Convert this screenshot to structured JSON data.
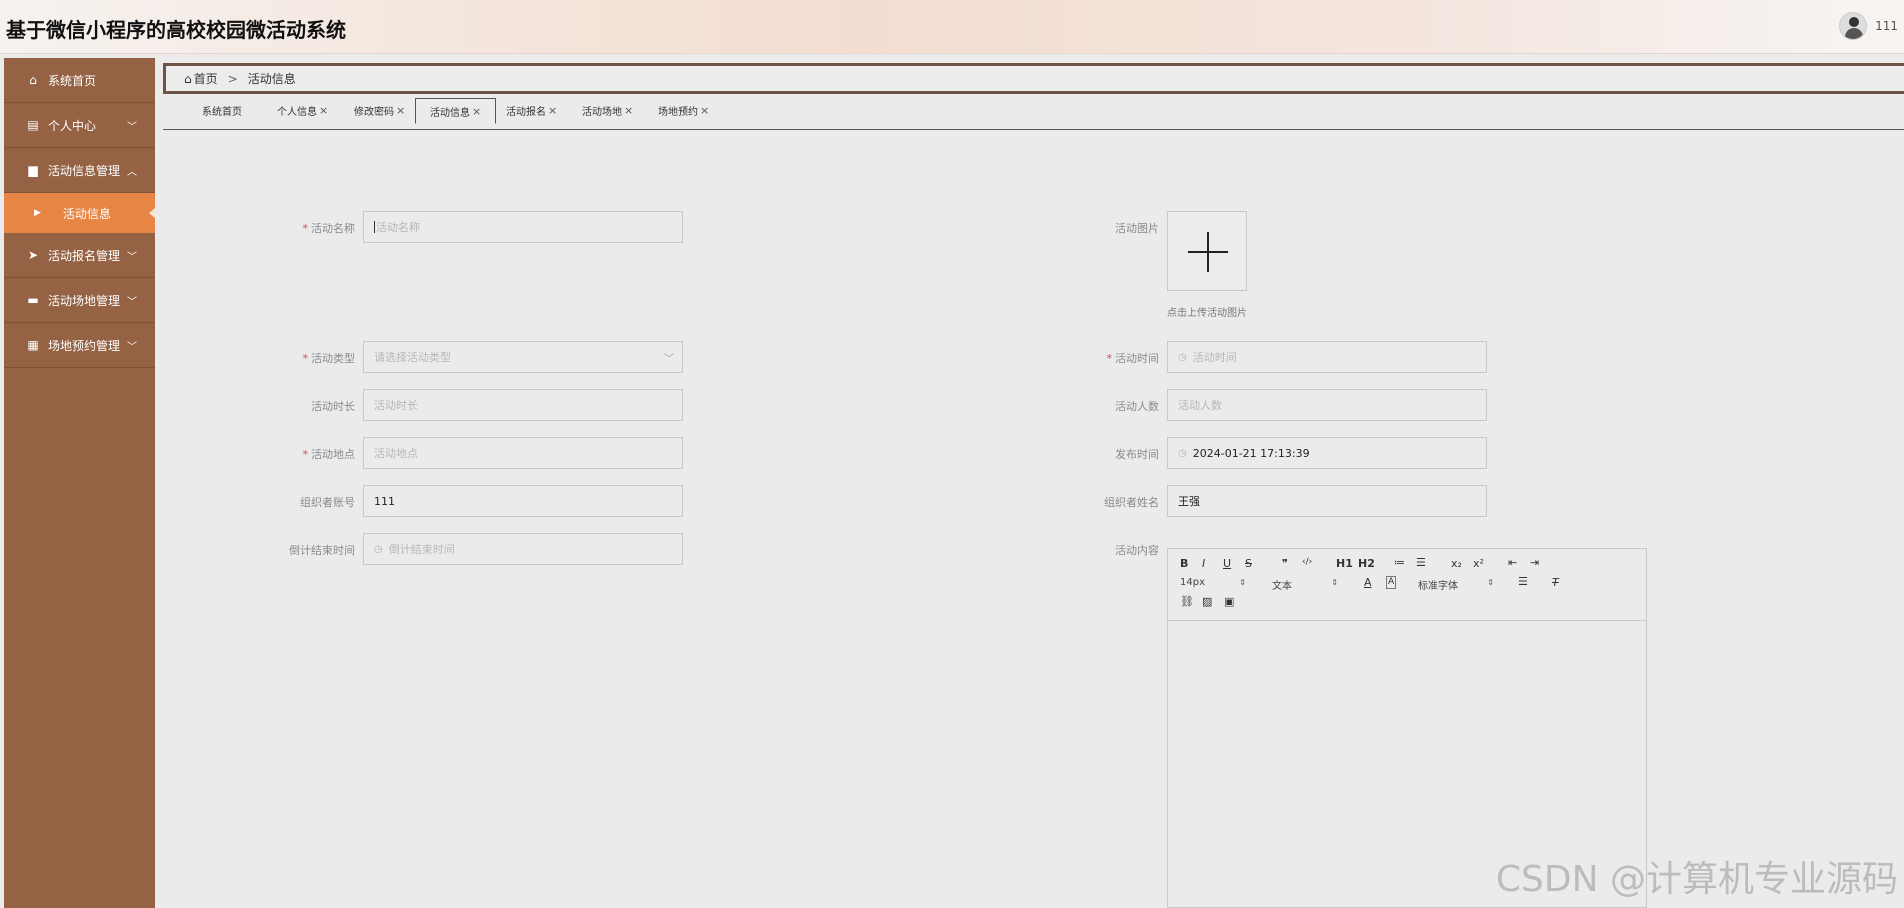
{
  "header": {
    "title": "基于微信小程序的高校校园微活动系统",
    "username": "111"
  },
  "sidebar": {
    "items": [
      {
        "label": "系统首页",
        "icon": "home-icon"
      },
      {
        "label": "个人中心",
        "icon": "calendar-icon"
      },
      {
        "label": "活动信息管理",
        "icon": "briefcase-icon"
      },
      {
        "label": "活动报名管理",
        "icon": "send-icon"
      },
      {
        "label": "活动场地管理",
        "icon": "printer-icon"
      },
      {
        "label": "场地预约管理",
        "icon": "grid-icon"
      }
    ],
    "active_sub": "活动信息"
  },
  "breadcrumb": {
    "home": "首页",
    "separator": ">",
    "current": "活动信息"
  },
  "tabs": [
    {
      "label": "系统首页"
    },
    {
      "label": "个人信息"
    },
    {
      "label": "修改密码"
    },
    {
      "label": "活动信息"
    },
    {
      "label": "活动报名"
    },
    {
      "label": "活动场地"
    },
    {
      "label": "场地预约"
    }
  ],
  "tab_close": "×",
  "form": {
    "name_label": "活动名称",
    "name_placeholder": "活动名称",
    "image_label": "活动图片",
    "image_hint": "点击上传活动图片",
    "type_label": "活动类型",
    "type_placeholder": "请选择活动类型",
    "time_label": "活动时间",
    "time_placeholder": "活动时间",
    "duration_label": "活动时长",
    "duration_placeholder": "活动时长",
    "count_label": "活动人数",
    "count_placeholder": "活动人数",
    "place_label": "活动地点",
    "place_placeholder": "活动地点",
    "publish_label": "发布时间",
    "publish_value": "2024-01-21 17:13:39",
    "org_account_label": "组织者账号",
    "org_account_value": "111",
    "org_name_label": "组织者姓名",
    "org_name_value": "王强",
    "countdown_label": "倒计结束时间",
    "countdown_placeholder": "倒计结束时间",
    "content_label": "活动内容"
  },
  "editor": {
    "row1": [
      "B",
      "I",
      "U",
      "S",
      "❞",
      "‹/›",
      "H1",
      "H2",
      "≔",
      "☰",
      "x₂",
      "x²",
      "⇤",
      "⇥"
    ],
    "font_size": "14px",
    "block_type": "文本",
    "font_family": "标准字体"
  },
  "watermark": "CSDN @计算机专业源码"
}
